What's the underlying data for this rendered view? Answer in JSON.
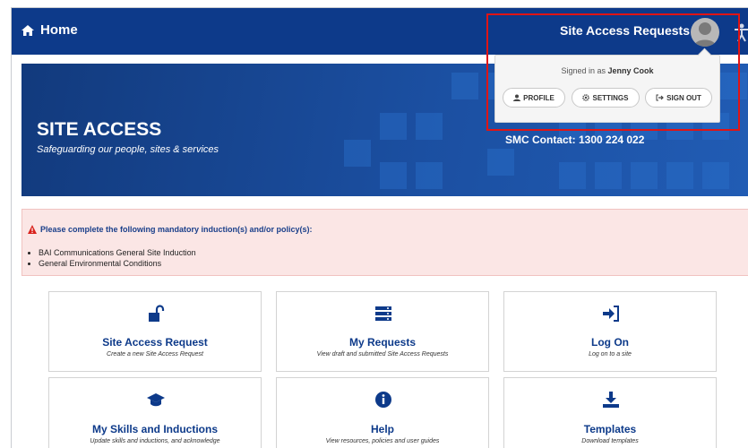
{
  "header": {
    "home_label": "Home",
    "app_title": "Site Access Requests",
    "accent_color": "#0d3a8a"
  },
  "user_menu": {
    "signed_in_prefix": "Signed in as",
    "user_name": "Jenny Cook",
    "buttons": [
      {
        "label": "PROFILE",
        "icon": "user-icon"
      },
      {
        "label": "SETTINGS",
        "icon": "gear-icon"
      },
      {
        "label": "SIGN OUT",
        "icon": "sign-out-icon"
      }
    ]
  },
  "hero": {
    "title": "SITE ACCESS",
    "subtitle": "Safeguarding our people, sites & services",
    "contact": "SMC Contact: 1300 224 022"
  },
  "alert": {
    "title": "Please complete the following mandatory induction(s) and/or policy(s):",
    "items": [
      "BAI Communications General Site Induction",
      "General Environmental Conditions"
    ],
    "color": "#fbe6e5"
  },
  "tiles": [
    {
      "title": "Site Access Request",
      "desc": "Create a new Site Access Request",
      "icon": "unlock-icon"
    },
    {
      "title": "My Requests",
      "desc": "View draft and submitted Site Access Requests",
      "icon": "server-list-icon"
    },
    {
      "title": "Log On",
      "desc": "Log on to a site",
      "icon": "sign-in-icon"
    },
    {
      "title": "My Skills and Inductions",
      "desc": "Update skills and inductions, and acknowledge",
      "icon": "graduation-cap-icon"
    },
    {
      "title": "Help",
      "desc": "View resources, policies and user guides",
      "icon": "info-circle-icon"
    },
    {
      "title": "Templates",
      "desc": "Download templates",
      "icon": "download-icon"
    }
  ]
}
